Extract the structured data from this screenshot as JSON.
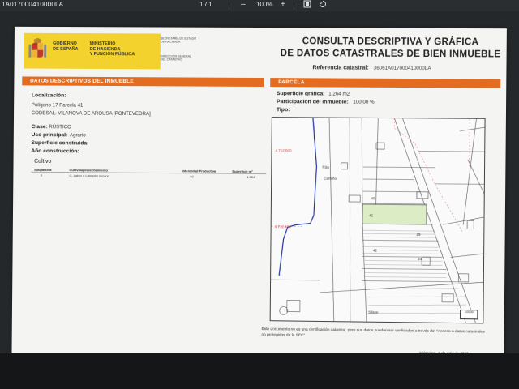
{
  "viewer": {
    "filename": "1A017000410000LA",
    "page_current": "1",
    "page_sep": "/",
    "page_total": "1",
    "zoom_out_label": "–",
    "zoom_level": "100%",
    "zoom_in_label": "+",
    "fit_icon": "fit-page-icon",
    "rotate_icon": "rotate-icon"
  },
  "header": {
    "gob_line1": "GOBIERNO",
    "gob_line2": "DE ESPAÑA",
    "min_line1": "MINISTERIO",
    "min_line2": "DE HACIENDA",
    "min_line3": "Y FUNCIÓN PÚBLICA",
    "sec_line1": "SECRETARÍA DE ESTADO",
    "sec_line2": "DE HACIENDA",
    "dir_line1": "DIRECCIÓN GENERAL",
    "dir_line2": "DEL CATASTRO",
    "title_line1": "CONSULTA DESCRIPTIVA Y GRÁFICA",
    "title_line2": "DE DATOS CATASTRALES DE BIEN INMUEBLE",
    "ref_label": "Referencia catastral:",
    "ref_value": "36061A017000410000LA"
  },
  "left": {
    "section_title": "DATOS DESCRIPTIVOS DEL INMUEBLE",
    "localizacion_label": "Localización:",
    "localizacion_line1": "Polígono 17 Parcela 41",
    "localizacion_line2": "CODESAL. VILANOVA DE AROUSA [PONTEVEDRA]",
    "clase_label": "Clase:",
    "clase_value": "RÚSTICO",
    "uso_label": "Uso principal:",
    "uso_value": "Agrario",
    "superficie_construida_label": "Superficie construida:",
    "anio_label": "Año construcción:",
    "cultivo_title": "Cultivo",
    "cultivo_headers": [
      "Subparcela",
      "Cultivo/aprovechamiento",
      "Intensidad Productiva",
      "Superficie m²"
    ],
    "cultivo_rows": [
      [
        "0",
        "C- Labor o Labradío secano",
        "02",
        "1.264"
      ]
    ]
  },
  "right": {
    "section_title": "PARCELA",
    "superficie_grafica_label": "Superficie gráfica:",
    "superficie_grafica_value": "1.264 m2",
    "participacion_label": "Participación del inmueble:",
    "participacion_value": "100,00 %",
    "tipo_label": "Tipo:",
    "map_labels": {
      "coord_top": "4.712.500",
      "coord_mid": "4.712.400",
      "p40": "40",
      "p41": "41",
      "p42": "42",
      "p29": "29",
      "p24": "24",
      "road": "Camiño",
      "bottom_name": "Silaxe",
      "left_name": "Rúa"
    },
    "scale_text": "1/2000",
    "footnote": "Este documento no es una certificación catastral, pero sus datos pueden ser verificados a través del \"Acceso a datos catastrales no protegidos de la SEC\"",
    "date_line": "Miércoles , 5 de Julio de 2023"
  }
}
